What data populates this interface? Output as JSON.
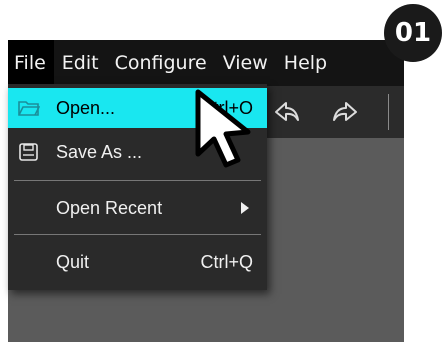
{
  "badge": "01",
  "menubar": [
    "File",
    "Edit",
    "Configure",
    "View",
    "Help"
  ],
  "file_menu": {
    "open": {
      "label": "Open...",
      "shortcut": "Ctrl+O",
      "icon": "folder-open-icon"
    },
    "save_as": {
      "label": "Save As ...",
      "icon": "save-as-icon"
    },
    "open_recent": {
      "label": "Open Recent",
      "icon": "chevron-right-icon"
    },
    "quit": {
      "label": "Quit",
      "shortcut": "Ctrl+Q"
    }
  },
  "toolbar": {
    "icons": [
      "undo-icon",
      "redo-icon"
    ]
  },
  "colors": {
    "highlight": "#19e7f0",
    "menubar": "#141414",
    "toolbar": "#2b2b2b",
    "workspace": "#5b5b5b",
    "menu_bg": "#2a2a2a"
  }
}
